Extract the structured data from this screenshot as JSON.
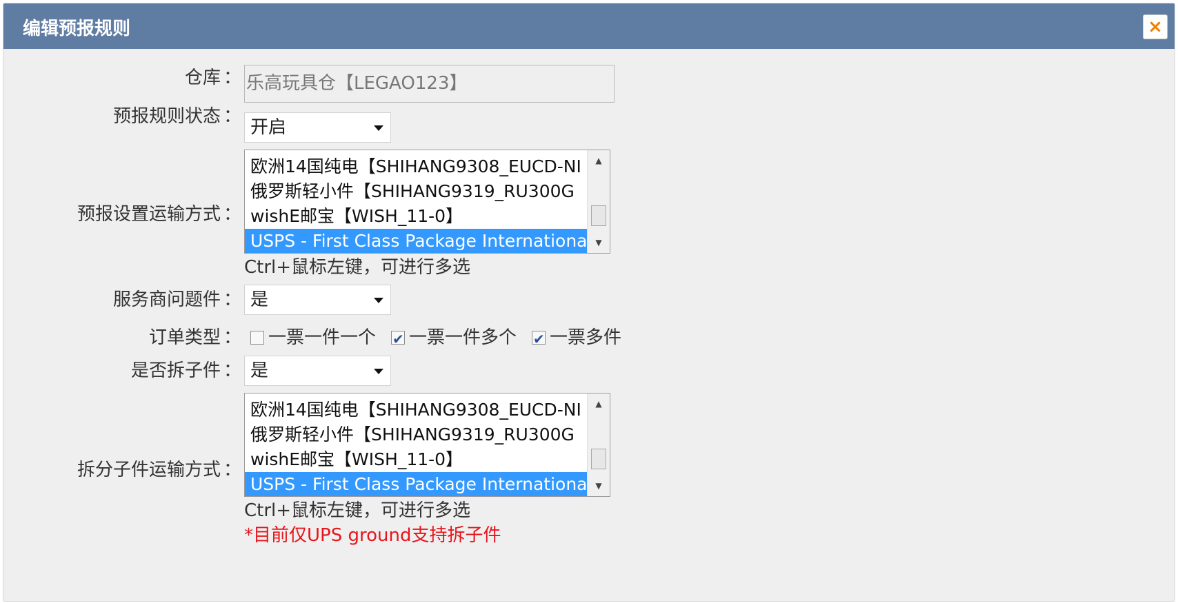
{
  "dialog": {
    "title": "编辑预报规则",
    "close_icon": "×"
  },
  "form": {
    "warehouse": {
      "label": "仓库",
      "value": "乐高玩具仓【LEGAO123】"
    },
    "rule_status": {
      "label": "预报规则状态",
      "selected": "开启"
    },
    "shipping_methods": {
      "label": "预报设置运输方式",
      "items": [
        "欧洲14国纯电【SHIHANG9308_EUCD-NI",
        "俄罗斯轻小件【SHIHANG9319_RU300G",
        "wishE邮宝【WISH_11-0】",
        "USPS - First Class Package Internationa"
      ],
      "selected_index": 3,
      "hint": "Ctrl+鼠标左键，可进行多选"
    },
    "provider_problem": {
      "label": "服务商问题件",
      "selected": "是"
    },
    "order_type": {
      "label": "订单类型",
      "options": [
        {
          "label": "一票一件一个",
          "checked": false
        },
        {
          "label": "一票一件多个",
          "checked": true
        },
        {
          "label": "一票多件",
          "checked": true
        }
      ]
    },
    "split_children": {
      "label": "是否拆子件",
      "selected": "是"
    },
    "split_methods": {
      "label": "拆分子件运输方式",
      "items": [
        "欧洲14国纯电【SHIHANG9308_EUCD-NI",
        "俄罗斯轻小件【SHIHANG9319_RU300G",
        "wishE邮宝【WISH_11-0】",
        "USPS - First Class Package Internationa"
      ],
      "selected_index": 3,
      "hint": "Ctrl+鼠标左键，可进行多选",
      "warning": "*目前仅UPS ground支持拆子件"
    },
    "colon": "："
  }
}
